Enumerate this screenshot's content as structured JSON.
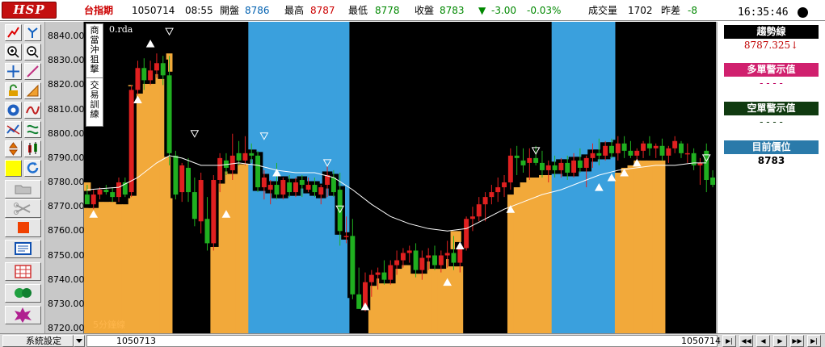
{
  "header": {
    "logo": "HSP",
    "symbol": "台指期",
    "date": "1050714",
    "time": "08:55",
    "open_label": "開盤",
    "open_value": "8786",
    "high_label": "最高",
    "high_value": "8787",
    "low_label": "最低",
    "low_value": "8778",
    "close_label": "收盤",
    "close_value": "8783",
    "change_value": "-3.00",
    "change_pct": "-0.03%",
    "volume_label": "成交量",
    "volume_value": "1702",
    "diff_label": "昨差",
    "diff_value": "-8",
    "clock": "16:35:46"
  },
  "colors": {
    "up": "#e02020",
    "down": "#20b020",
    "accent_orange": "#f2a93a",
    "accent_blue": "#3aa0dd"
  },
  "toolbar_icons": [
    "trend-line-icon",
    "split-chart-icon",
    "zoom-in-icon",
    "zoom-out-icon",
    "crosshair-icon",
    "pen-line-icon",
    "lock-icon",
    "ruler-icon",
    "indicator-icon",
    "wave-icon",
    "chart-type-icon",
    "swap-icon",
    "updown-icon",
    "candle-icon",
    "highlight-icon",
    "refresh-icon",
    "folder-icon",
    "scissors-icon",
    "stop-icon",
    "screen-icon",
    "grid-table-icon",
    "gloves-icon",
    "star-burst-icon"
  ],
  "side_menu": {
    "group1": [
      "商",
      "當",
      "沖",
      "狙",
      "擊"
    ],
    "group2": [
      "交",
      "易",
      "訓",
      "練"
    ]
  },
  "chart": {
    "formula_label": "0.rda",
    "timeframe_label": "5分鐘線"
  },
  "chart_data": {
    "type": "candlestick",
    "ylim": [
      8718,
      8846
    ],
    "yticks": [
      "8840.00",
      "8830.00",
      "8820.00",
      "8810.00",
      "8800.00",
      "8790.00",
      "8780.00",
      "8770.00",
      "8760.00",
      "8750.00",
      "8740.00",
      "8730.00",
      "8720.00"
    ],
    "ytick_values": [
      8840,
      8830,
      8820,
      8810,
      8800,
      8790,
      8780,
      8770,
      8760,
      8750,
      8740,
      8730,
      8720
    ],
    "candles": [
      [
        8775,
        8779,
        8772,
        8771
      ],
      [
        8771,
        8777,
        8769,
        8775
      ],
      [
        8775,
        8778,
        8773,
        8777
      ],
      [
        8777,
        8779,
        8775,
        8776
      ],
      [
        8776,
        8778,
        8772,
        8774
      ],
      [
        8774,
        8782,
        8772,
        8780
      ],
      [
        8780,
        8782,
        8774,
        8775
      ],
      [
        8776,
        8820,
        8774,
        8818
      ],
      [
        8818,
        8830,
        8816,
        8827
      ],
      [
        8827,
        8831,
        8818,
        8822
      ],
      [
        8822,
        8830,
        8820,
        8826
      ],
      [
        8826,
        8833,
        8823,
        8829
      ],
      [
        8829,
        8832,
        8820,
        8824
      ],
      [
        8824,
        8832,
        8787,
        8792
      ],
      [
        8791,
        8793,
        8773,
        8775
      ],
      [
        8776,
        8788,
        8772,
        8787
      ],
      [
        8786,
        8790,
        8772,
        8776
      ],
      [
        8776,
        8782,
        8762,
        8765
      ],
      [
        8764,
        8784,
        8759,
        8781
      ],
      [
        8765,
        8774,
        8752,
        8755
      ],
      [
        8755,
        8783,
        8752,
        8781
      ],
      [
        8781,
        8792,
        8776,
        8790
      ],
      [
        8789,
        8792,
        8783,
        8786
      ],
      [
        8785,
        8800,
        8781,
        8791
      ],
      [
        8792,
        8797,
        8787,
        8789
      ],
      [
        8789,
        8799,
        8787,
        8792
      ],
      [
        8792,
        8796,
        8788,
        8791
      ],
      [
        8791,
        8793,
        8776,
        8778
      ],
      [
        8778,
        8785,
        8773,
        8782
      ],
      [
        8777,
        8781,
        8771,
        8779
      ],
      [
        8779,
        8788,
        8773,
        8775
      ],
      [
        8775,
        8782,
        8773,
        8781
      ],
      [
        8780,
        8783,
        8774,
        8776
      ],
      [
        8776,
        8782,
        8774,
        8780
      ],
      [
        8781,
        8783,
        8774,
        8779
      ],
      [
        8777,
        8782,
        8776,
        8779
      ],
      [
        8779,
        8782,
        8774,
        8776
      ],
      [
        8775,
        8779,
        8771,
        8778
      ],
      [
        8779,
        8787,
        8774,
        8783
      ],
      [
        8782,
        8785,
        8774,
        8776
      ],
      [
        8777,
        8784,
        8754,
        8760
      ],
      [
        8758,
        8766,
        8755,
        8758
      ],
      [
        8758,
        8765,
        8732,
        8734
      ],
      [
        8734,
        8745,
        8728,
        8728
      ],
      [
        8729,
        8743,
        8727,
        8739
      ],
      [
        8739,
        8744,
        8733,
        8742
      ],
      [
        8742,
        8745,
        8736,
        8743
      ],
      [
        8743,
        8748,
        8738,
        8740
      ],
      [
        8740,
        8748,
        8738,
        8746
      ],
      [
        8746,
        8752,
        8742,
        8748
      ],
      [
        8748,
        8753,
        8745,
        8751
      ],
      [
        8751,
        8754,
        8747,
        8752
      ],
      [
        8752,
        8755,
        8741,
        8744
      ],
      [
        8744,
        8752,
        8740,
        8749
      ],
      [
        8749,
        8753,
        8744,
        8750
      ],
      [
        8750,
        8754,
        8744,
        8746
      ],
      [
        8746,
        8752,
        8743,
        8750
      ],
      [
        8750,
        8756,
        8745,
        8751
      ],
      [
        8751,
        8758,
        8744,
        8747
      ],
      [
        8747,
        8755,
        8743,
        8754
      ],
      [
        8753,
        8766,
        8752,
        8765
      ],
      [
        8765,
        8770,
        8760,
        8766
      ],
      [
        8766,
        8774,
        8764,
        8771
      ],
      [
        8771,
        8776,
        8764,
        8774
      ],
      [
        8774,
        8779,
        8771,
        8776
      ],
      [
        8776,
        8782,
        8772,
        8778
      ],
      [
        8778,
        8783,
        8774,
        8780
      ],
      [
        8780,
        8794,
        8777,
        8791
      ],
      [
        8791,
        8795,
        8783,
        8790
      ],
      [
        8789,
        8794,
        8784,
        8787
      ],
      [
        8788,
        8794,
        8781,
        8790
      ],
      [
        8790,
        8795,
        8787,
        8788
      ],
      [
        8788,
        8793,
        8782,
        8785
      ],
      [
        8785,
        8789,
        8780,
        8787
      ],
      [
        8787,
        8791,
        8782,
        8785
      ],
      [
        8785,
        8790,
        8782,
        8788
      ],
      [
        8788,
        8791,
        8781,
        8784
      ],
      [
        8784,
        8792,
        8782,
        8789
      ],
      [
        8789,
        8794,
        8784,
        8786
      ],
      [
        8786,
        8791,
        8778,
        8790
      ],
      [
        8790,
        8796,
        8786,
        8792
      ],
      [
        8792,
        8798,
        8787,
        8791
      ],
      [
        8791,
        8797,
        8789,
        8795
      ],
      [
        8795,
        8798,
        8790,
        8792
      ],
      [
        8792,
        8799,
        8789,
        8796
      ],
      [
        8796,
        8799,
        8790,
        8793
      ],
      [
        8793,
        8797,
        8790,
        8791
      ],
      [
        8791,
        8794,
        8789,
        8793
      ],
      [
        8793,
        8797,
        8790,
        8796
      ],
      [
        8796,
        8799,
        8791,
        8794
      ],
      [
        8794,
        8796,
        8790,
        8795
      ],
      [
        8795,
        8798,
        8789,
        8791
      ],
      [
        8791,
        8795,
        8788,
        8794
      ],
      [
        8794,
        8799,
        8792,
        8797
      ],
      [
        8796,
        8797,
        8790,
        8792
      ],
      [
        8792,
        8796,
        8788,
        8792
      ],
      [
        8792,
        8794,
        8785,
        8787
      ],
      [
        8787,
        8790,
        8779,
        8788
      ],
      [
        8793,
        8796,
        8776,
        8781
      ],
      [
        8782,
        8785,
        8778,
        8779
      ]
    ],
    "fill_bands": [
      [
        8780,
        "orange"
      ],
      [
        8774,
        "orange"
      ],
      [
        8772,
        "orange"
      ],
      [
        8772,
        "orange"
      ],
      [
        8772,
        "orange"
      ],
      [
        8771,
        "orange"
      ],
      [
        8771,
        "orange"
      ],
      [
        8820,
        "orange"
      ],
      [
        8823,
        "orange"
      ],
      [
        8825,
        "orange"
      ],
      [
        8826,
        "orange"
      ],
      [
        8829,
        "orange"
      ],
      [
        8830,
        "orange"
      ],
      [
        8833,
        "orange"
      ],
      [
        8846,
        "black"
      ],
      [
        8846,
        "black"
      ],
      [
        8846,
        "black"
      ],
      [
        8846,
        "black"
      ],
      [
        8846,
        "black"
      ],
      [
        8846,
        "black"
      ],
      [
        8782,
        "orange"
      ],
      [
        8786,
        "orange"
      ],
      [
        8787,
        "orange"
      ],
      [
        8789,
        "orange"
      ],
      [
        8789,
        "orange"
      ],
      [
        8789,
        "orange"
      ],
      [
        8846,
        "blue"
      ],
      [
        8846,
        "blue"
      ],
      [
        8846,
        "blue"
      ],
      [
        8846,
        "blue"
      ],
      [
        8846,
        "blue"
      ],
      [
        8846,
        "blue"
      ],
      [
        8846,
        "blue"
      ],
      [
        8846,
        "blue"
      ],
      [
        8846,
        "blue"
      ],
      [
        8846,
        "blue"
      ],
      [
        8846,
        "blue"
      ],
      [
        8846,
        "blue"
      ],
      [
        8846,
        "blue"
      ],
      [
        8846,
        "blue"
      ],
      [
        8846,
        "blue"
      ],
      [
        8846,
        "blue"
      ],
      [
        8846,
        "black"
      ],
      [
        8846,
        "black"
      ],
      [
        8846,
        "black"
      ],
      [
        8738,
        "orange"
      ],
      [
        8742,
        "orange"
      ],
      [
        8744,
        "orange"
      ],
      [
        8745,
        "orange"
      ],
      [
        8746,
        "orange"
      ],
      [
        8746,
        "orange"
      ],
      [
        8746,
        "orange"
      ],
      [
        8746,
        "orange"
      ],
      [
        8748,
        "orange"
      ],
      [
        8749,
        "orange"
      ],
      [
        8749,
        "orange"
      ],
      [
        8750,
        "orange"
      ],
      [
        8752,
        "orange"
      ],
      [
        8760,
        "orange"
      ],
      [
        8760,
        "orange"
      ],
      [
        8846,
        "black"
      ],
      [
        8846,
        "black"
      ],
      [
        8846,
        "black"
      ],
      [
        8846,
        "black"
      ],
      [
        8846,
        "black"
      ],
      [
        8846,
        "black"
      ],
      [
        8846,
        "black"
      ],
      [
        8775,
        "orange"
      ],
      [
        8778,
        "orange"
      ],
      [
        8780,
        "orange"
      ],
      [
        8782,
        "orange"
      ],
      [
        8782,
        "orange"
      ],
      [
        8783,
        "orange"
      ],
      [
        8783,
        "orange"
      ],
      [
        8846,
        "blue"
      ],
      [
        8846,
        "blue"
      ],
      [
        8846,
        "blue"
      ],
      [
        8846,
        "blue"
      ],
      [
        8846,
        "blue"
      ],
      [
        8846,
        "blue"
      ],
      [
        8846,
        "blue"
      ],
      [
        8846,
        "blue"
      ],
      [
        8846,
        "blue"
      ],
      [
        8846,
        "blue"
      ],
      [
        8784,
        "orange"
      ],
      [
        8786,
        "orange"
      ],
      [
        8787,
        "orange"
      ],
      [
        8789,
        "orange"
      ],
      [
        8789,
        "orange"
      ],
      [
        8789,
        "orange"
      ],
      [
        8789,
        "orange"
      ],
      [
        8789,
        "orange"
      ],
      [
        8846,
        "black"
      ],
      [
        8846,
        "black"
      ],
      [
        8846,
        "black"
      ],
      [
        8846,
        "black"
      ],
      [
        8846,
        "black"
      ],
      [
        8846,
        "black"
      ],
      [
        8846,
        "black"
      ],
      [
        8846,
        "black"
      ],
      [
        8846,
        "black"
      ],
      [
        8846,
        "black"
      ]
    ],
    "moving_average": [
      [
        0,
        8777
      ],
      [
        5,
        8778
      ],
      [
        8,
        8782
      ],
      [
        11,
        8788
      ],
      [
        13,
        8791
      ],
      [
        15,
        8790
      ],
      [
        18,
        8787
      ],
      [
        21,
        8787
      ],
      [
        24,
        8788
      ],
      [
        27,
        8787
      ],
      [
        30,
        8785
      ],
      [
        33,
        8784
      ],
      [
        36,
        8784
      ],
      [
        39,
        8782
      ],
      [
        42,
        8777
      ],
      [
        45,
        8771
      ],
      [
        48,
        8766
      ],
      [
        51,
        8763
      ],
      [
        54,
        8761
      ],
      [
        57,
        8760
      ],
      [
        60,
        8761
      ],
      [
        63,
        8765
      ],
      [
        66,
        8769
      ],
      [
        69,
        8772
      ],
      [
        72,
        8775
      ],
      [
        75,
        8777
      ],
      [
        78,
        8780
      ],
      [
        81,
        8783
      ],
      [
        84,
        8785
      ],
      [
        87,
        8786
      ],
      [
        90,
        8787
      ],
      [
        93,
        8787
      ],
      [
        96,
        8788
      ],
      [
        98,
        8788
      ]
    ],
    "signals": [
      [
        1,
        8767,
        "up"
      ],
      [
        8,
        8814,
        "up"
      ],
      [
        10,
        8837,
        "up"
      ],
      [
        13,
        8842,
        "down"
      ],
      [
        17,
        8800,
        "down"
      ],
      [
        22,
        8767,
        "up"
      ],
      [
        28,
        8799,
        "down"
      ],
      [
        30,
        8784,
        "up"
      ],
      [
        38,
        8788,
        "down"
      ],
      [
        40,
        8769,
        "down"
      ],
      [
        44,
        8729,
        "up"
      ],
      [
        57,
        8739,
        "up"
      ],
      [
        59,
        8754,
        "up"
      ],
      [
        67,
        8769,
        "up"
      ],
      [
        71,
        8793,
        "down"
      ],
      [
        81,
        8778,
        "up"
      ],
      [
        83,
        8782,
        "up"
      ],
      [
        85,
        8784,
        "up"
      ],
      [
        87,
        8788,
        "up"
      ],
      [
        98,
        8790,
        "down"
      ]
    ]
  },
  "right_panel": {
    "trend_label": "趨勢線",
    "trend_value": "8787.325↓",
    "long_label": "多單警示值",
    "long_value": "- - - -",
    "short_label": "空單警示值",
    "short_value": "- - - -",
    "current_label": "目前價位",
    "current_value": "8783"
  },
  "bottom": {
    "system_label": "系統設定",
    "date_left": "1050713",
    "date_right": "1050714",
    "nav": [
      "▶|",
      "◀◀",
      "◀",
      "▶",
      "▶▶",
      "▶|"
    ]
  }
}
